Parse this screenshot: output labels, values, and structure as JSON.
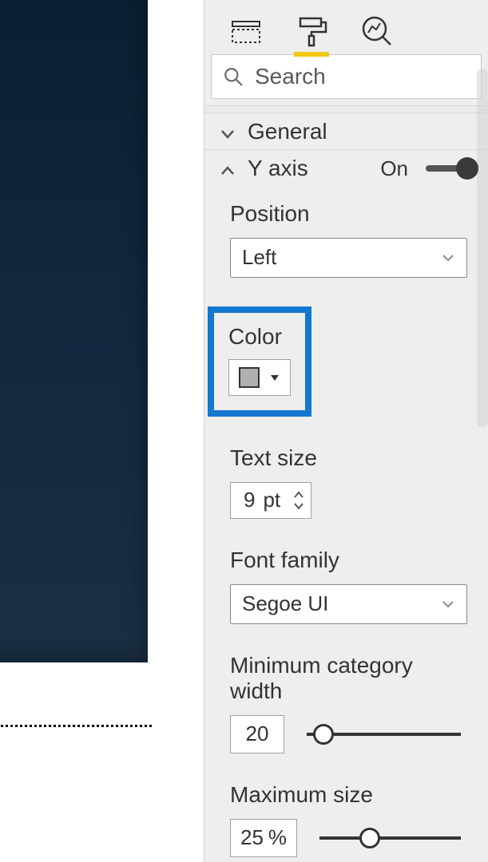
{
  "search": {
    "placeholder": "Search"
  },
  "tabs": {
    "active_index": 1,
    "names": [
      "fields-tab",
      "format-tab",
      "analytics-tab"
    ]
  },
  "sections": {
    "general": {
      "label": "General",
      "expanded": false
    },
    "y_axis": {
      "label": "Y axis",
      "expanded": true,
      "toggle_label": "On",
      "toggle_on": true
    }
  },
  "y_axis": {
    "position": {
      "label": "Position",
      "value": "Left"
    },
    "color": {
      "label": "Color",
      "value_hex": "#b0b0b0"
    },
    "text_size": {
      "label": "Text size",
      "value": "9",
      "unit": "pt"
    },
    "font_family": {
      "label": "Font family",
      "value": "Segoe UI"
    },
    "min_category_width": {
      "label": "Minimum category width",
      "value": "20",
      "slider_percent": 4
    },
    "max_size": {
      "label": "Maximum size",
      "value": "25",
      "unit": "%",
      "slider_percent": 28
    }
  }
}
